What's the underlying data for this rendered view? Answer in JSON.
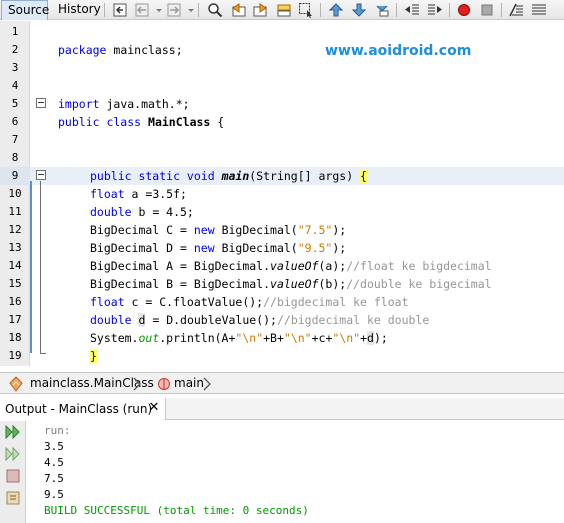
{
  "toolbar": {
    "tab_source": "Source",
    "tab_history": "History",
    "buttons": [
      "last-edit-icon",
      "back-icon",
      "forward-icon",
      "find-icon",
      "find-previous-icon",
      "find-next-icon",
      "toggle-highlight-icon",
      "select-icon",
      "prev-bookmark-icon",
      "next-bookmark-icon",
      "toggle-bookmark-icon",
      "shift-left-icon",
      "shift-right-icon",
      "start-macro-icon",
      "stop-macro-icon",
      "comment-icon",
      "uncomment-icon"
    ]
  },
  "editor": {
    "watermark": "www.aoidroid.com",
    "line_numbers": [
      "1",
      "2",
      "3",
      "4",
      "5",
      "6",
      "7",
      "8",
      "9",
      "10",
      "11",
      "12",
      "13",
      "14",
      "15",
      "16",
      "17",
      "18",
      "19"
    ],
    "line2": {
      "kw": "package",
      "rest": " mainclass;"
    },
    "line5": {
      "kw": "import",
      "rest": " java.math.*;"
    },
    "line6": {
      "kw": "public class",
      "name": "MainClass",
      "rest": " {"
    },
    "line9": {
      "kw": "public static void",
      "name": "main",
      "rest": "(String[] args) ",
      "brace": "{"
    },
    "line10": {
      "kw": "float",
      "rest": " a =3.5f;"
    },
    "line11": {
      "kw": "double",
      "rest": " b = 4.5;"
    },
    "line12": {
      "a": "BigDecimal C = ",
      "kw": "new",
      "b": " BigDecimal(",
      "str": "\"7.5\"",
      "c": ");"
    },
    "line13": {
      "a": "BigDecimal D = ",
      "kw": "new",
      "b": " BigDecimal(",
      "str": "\"9.5\"",
      "c": ");"
    },
    "line14": {
      "a": "BigDecimal A = BigDecimal.",
      "st": "valueOf",
      "b": "(a);",
      "cm": "//float ke bigdecimal"
    },
    "line15": {
      "a": "BigDecimal B = BigDecimal.",
      "st": "valueOf",
      "b": "(b);",
      "cm": "//double ke bigecimal"
    },
    "line16": {
      "kw": "float",
      "a": " c = C.floatValue();",
      "cm": "//bigdecimal ke float"
    },
    "line17": {
      "kw": "double",
      "var": "d",
      "a": " = D.doubleValue();",
      "cm": "//bigdecimal ke double"
    },
    "line18": {
      "a": "System.",
      "fld": "out",
      "b": ".println(A+",
      "s1": "\"\\n\"",
      "c": "+B+",
      "s2": "\"\\n\"",
      "d": "+c+",
      "s3": "\"\\n\"",
      "e": "+",
      "var": "d",
      "f": ");"
    },
    "line19": {
      "brace": "}"
    }
  },
  "breadcrumb": {
    "class_label": "mainclass.MainClass",
    "method_label": "main"
  },
  "output": {
    "title": "Output - MainClass (run)",
    "close": "✕",
    "lines": {
      "run": "run:",
      "v1": "3.5",
      "v2": "4.5",
      "v3": "7.5",
      "v4": "9.5",
      "build": "BUILD SUCCESSFUL (total time: 0 seconds)"
    }
  },
  "colors": {
    "keyword": "#0000e6",
    "string": "#ce7b00",
    "comment": "#969696",
    "field": "#009900",
    "watermark": "#1e8fd8",
    "highlight_row": "#e9eff8",
    "brace_match": "#ffff66"
  }
}
